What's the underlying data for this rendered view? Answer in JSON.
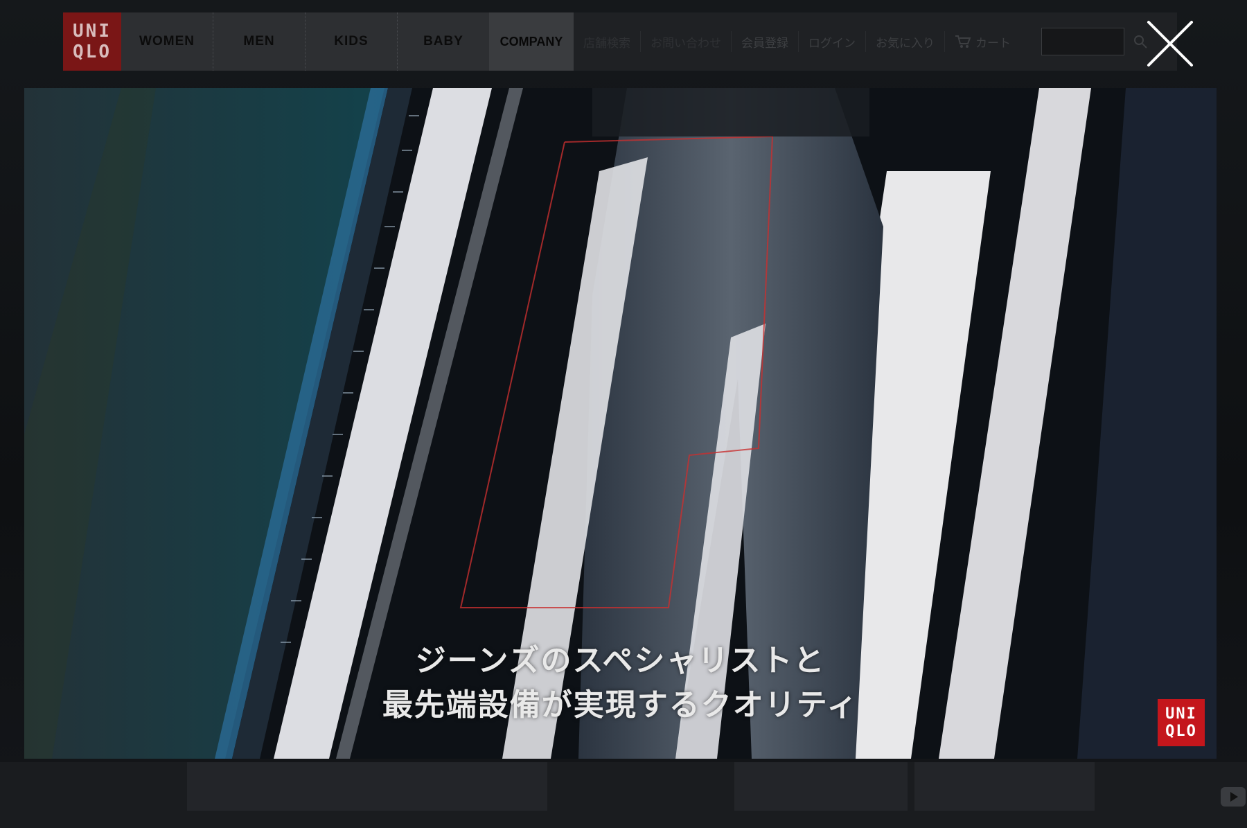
{
  "brand": {
    "logo_line1": "UNI",
    "logo_line2": "QLO"
  },
  "nav": {
    "main_items": [
      "WOMEN",
      "MEN",
      "KIDS",
      "BABY"
    ],
    "company": "COMPANY",
    "util_items": [
      "店舗検索",
      "お問い合わせ",
      "会員登録",
      "ログイン",
      "お気に入り"
    ],
    "cart_label": "カート",
    "search_placeholder": ""
  },
  "video": {
    "subtitle_line1": "ジーンズのスペシャリストと",
    "subtitle_line2": "最先端設備が実現するクオリティ",
    "corner_logo_line1": "UNI",
    "corner_logo_line2": "QLO"
  },
  "colors": {
    "brand_red": "#c4161c",
    "overlay_dim": "#1f2124"
  },
  "icons": {
    "close": "close-icon",
    "cart": "cart-icon",
    "search": "search-icon",
    "play": "play-icon"
  }
}
